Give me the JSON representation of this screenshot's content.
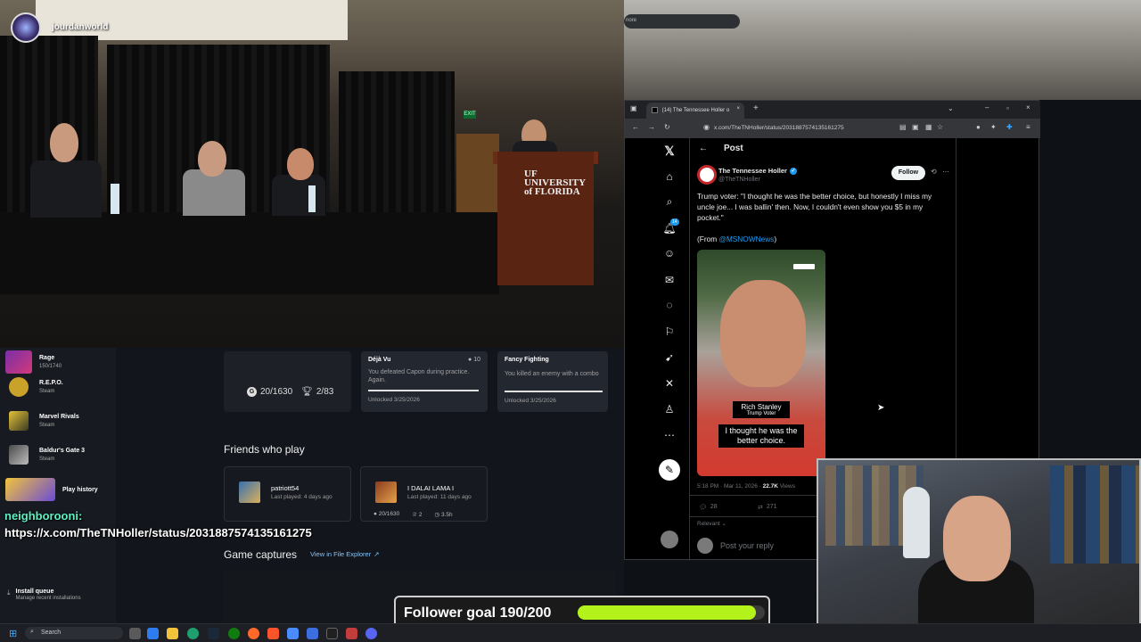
{
  "stream": {
    "channel_name": "jourdanworld",
    "podium_text": "UF UNIVERSITY of FLORIDA",
    "exit_sign": "EXIT"
  },
  "chat": {
    "username": "neighborooni:",
    "message": "https://x.com/TheTNHoller/status/2031887574135161275"
  },
  "follower_goal": {
    "label": "Follower goal 190/200",
    "current": 190,
    "target": 200,
    "color": "#b4f21c"
  },
  "xbox": {
    "games": [
      {
        "name": "Rage",
        "sub": "150/1740"
      },
      {
        "name": "R.E.P.O.",
        "sub": "Steam"
      },
      {
        "name": "Marvel Rivals",
        "sub": "Steam"
      },
      {
        "name": "Baldur's Gate 3",
        "sub": "Steam"
      }
    ],
    "play_history": "Play history",
    "gamerscore": "20/1630",
    "trophies": "2/83",
    "achievements": [
      {
        "title": "Déjà Vu",
        "points": "10",
        "desc": "You defeated Capon during practice. Again.",
        "date": "Unlocked 3/25/2026"
      },
      {
        "title": "Fancy Fighting",
        "desc": "You killed an enemy with a combo",
        "date": "Unlocked 3/25/2026"
      }
    ],
    "friends_title": "Friends who play",
    "friends": [
      {
        "name": "patriott54",
        "sub": "Last played: 4 days ago"
      },
      {
        "name": "I DALAI LAMA I",
        "sub": "Last played: 11 days ago",
        "score": "20/1630",
        "trophies": "2",
        "hours": "3.5h"
      }
    ],
    "captures_title": "Game captures",
    "captures_link": "View in File Explorer",
    "install_queue": "Install queue",
    "install_sub": "Manage recent installations"
  },
  "browser": {
    "desktop_search": "nore",
    "tab_title": "(14) The Tennessee Holler o",
    "url": "x.com/TheTNHoller/status/2031887574135161275",
    "header": "Post",
    "author_name": "The Tennessee Holler",
    "author_handle": "@TheTNHoller",
    "follow_label": "Follow",
    "post_text": "Trump voter: \"I thought he was the better choice, but honestly I miss my uncle joe... I was ballin' then. Now, I couldn't even show you $5 in my pocket.\"",
    "from_prefix": "(From ",
    "from_handle": "@MSNOWNews",
    "from_suffix": ")",
    "video_caption_name": "Rich Stanley",
    "video_caption_role": "Trump Voter",
    "video_subtitle": "I thought he was the better choice.",
    "timestamp": "5:18 PM · Mar 11, 2026 · ",
    "views": "22.7K",
    "views_label": " Views",
    "replies": "28",
    "reposts": "271",
    "relevant": "Relevant",
    "reply_placeholder": "Post your reply",
    "notif_count": "14"
  },
  "taskbar": {
    "search_label": "Search"
  }
}
